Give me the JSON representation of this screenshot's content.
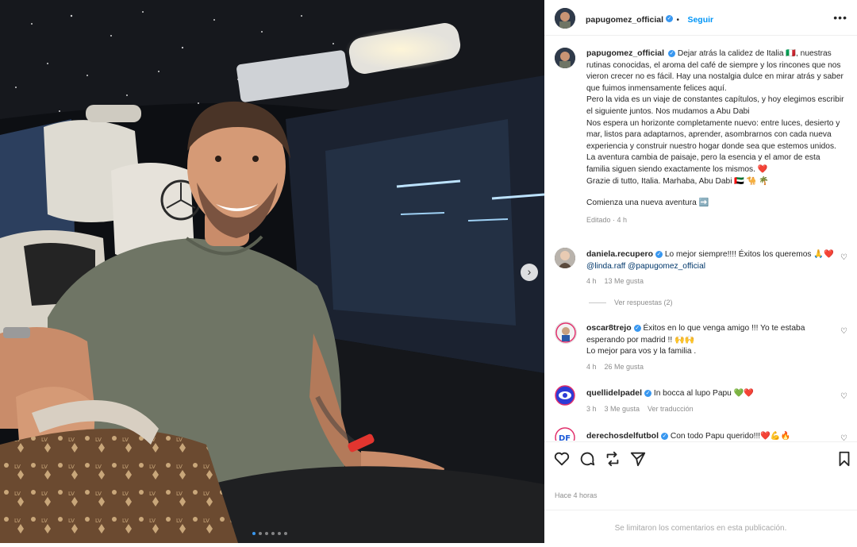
{
  "post": {
    "username": "papugomez_official",
    "follow_label": "Seguir",
    "more_label": "•••",
    "caption": {
      "paragraphs": [
        "Dejar atrás la calidez de Italia 🇮🇹, nuestras rutinas conocidas, el aroma del café de siempre y los rincones que nos vieron crecer no es fácil. Hay una nostalgia dulce en mirar atrás y saber que fuimos inmensamente felices aquí.",
        "Pero la vida es un viaje de constantes capítulos, y hoy elegimos escribir el siguiente juntos. Nos mudamos a Abu Dabi",
        "Nos espera un horizonte completamente nuevo: entre luces, desierto y mar, listos para adaptarnos, aprender, asombrarnos con cada nueva experiencia y construir nuestro hogar donde sea que estemos unidos. La aventura cambia de paisaje, pero la esencia y el amor de esta familia siguen siendo exactamente los mismos. ❤️",
        "Grazie di tutto, Italia. Marhaba, Abu Dabi 🇦🇪 🐪 🌴",
        "Comienza una nueva aventura ➡️"
      ],
      "edited": "Editado · 4 h"
    },
    "comments": [
      {
        "user": "daniela.recupero",
        "text": "Lo mejor siempre!!!! Éxitos los queremos 🙏❤️",
        "mentions": "@linda.raff @papugomez_official",
        "time": "4 h",
        "likes": "13 Me gusta",
        "replies": "Ver respuestas (2)"
      },
      {
        "user": "oscar8trejo",
        "text": "Éxitos en lo que venga amigo !!! Yo te estaba esperando por madrid !! 🙌🙌",
        "text2": "Lo mejor para vos y la familia .",
        "time": "4 h",
        "likes": "26 Me gusta"
      },
      {
        "user": "quellidelpadel",
        "text": "In bocca al lupo Papu 💚❤️",
        "time": "3 h",
        "likes": "3 Me gusta",
        "translate": "Ver traducción"
      },
      {
        "user": "derechosdelfutbol",
        "text": "Con todo Papu querido!!!❤️💪🔥"
      }
    ],
    "timestamp": "Hace 4 horas",
    "comments_limited": "Se limitaron los comentarios en esta publicación."
  },
  "carousel": {
    "dot_count": 6,
    "active_index": 0,
    "next_label": "›"
  },
  "icons": [
    "like-icon",
    "comment-icon",
    "share-icon",
    "send-icon",
    "save-icon",
    "verified-icon"
  ],
  "colors": {
    "accent": "#0095f6",
    "verified": "#3897f0",
    "muted": "#8e8e8e"
  }
}
